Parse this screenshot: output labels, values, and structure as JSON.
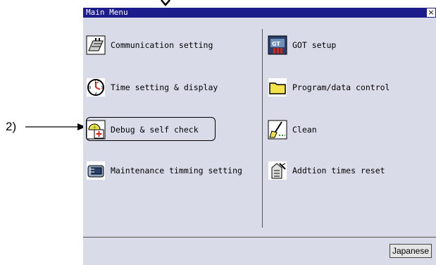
{
  "window": {
    "title": "Main Menu",
    "close_label": "×"
  },
  "callout": {
    "label": "2)"
  },
  "menu": {
    "left": [
      {
        "label": "Communication setting",
        "icon": "communication-icon"
      },
      {
        "label": "Time setting & display",
        "icon": "clock-icon"
      },
      {
        "label": "Debug & self check",
        "icon": "debug-icon"
      },
      {
        "label": "Maintenance timming setting",
        "icon": "maintenance-icon"
      }
    ],
    "right": [
      {
        "label": "GOT setup",
        "icon": "got-setup-icon"
      },
      {
        "label": "Program/data control",
        "icon": "folder-icon"
      },
      {
        "label": "Clean",
        "icon": "broom-icon"
      },
      {
        "label": "Addtion times reset",
        "icon": "reset-icon"
      }
    ]
  },
  "footer": {
    "language_button": "Japanese"
  },
  "colors": {
    "title_bar": "#1c1c8c",
    "screen_bg": "#d9dbe9",
    "folder": "#f4e24a"
  }
}
